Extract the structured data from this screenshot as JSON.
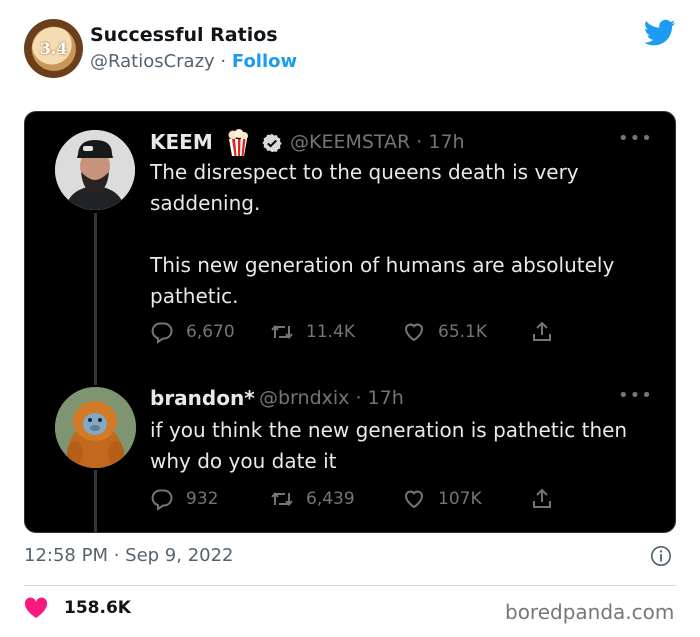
{
  "account": {
    "avatar_text": "3.4",
    "name": "Successful Ratios",
    "handle": "@RatiosCrazy",
    "separator": " · ",
    "follow_label": "Follow"
  },
  "tweets": [
    {
      "name": "KEEM",
      "handle_time": "@KEEMSTAR · 17h",
      "text": "The disrespect to the queens death is very\nsaddening.\n\nThis new generation of humans are absolutely\npathetic.",
      "replies": "6,670",
      "retweets": "11.4K",
      "likes": "65.1K"
    },
    {
      "name": "brandon*",
      "handle_time": "@brndxix · 17h",
      "text": "if you think the new generation is pathetic then\nwhy do you date it",
      "replies": "932",
      "retweets": "6,439",
      "likes": "107K"
    }
  ],
  "footer": {
    "timestamp": "12:58 PM · Sep 9, 2022",
    "like_count": "158.6K",
    "watermark": "boredpanda.com"
  },
  "colors": {
    "twitter_blue": "#1d9bf0",
    "card_bg": "#000000",
    "heart": "#f91880"
  },
  "icons": [
    "twitter-bird-icon",
    "popcorn-icon",
    "verified-icon",
    "more-icon",
    "reply-icon",
    "retweet-icon",
    "like-icon",
    "share-icon",
    "info-icon",
    "heart-icon"
  ]
}
